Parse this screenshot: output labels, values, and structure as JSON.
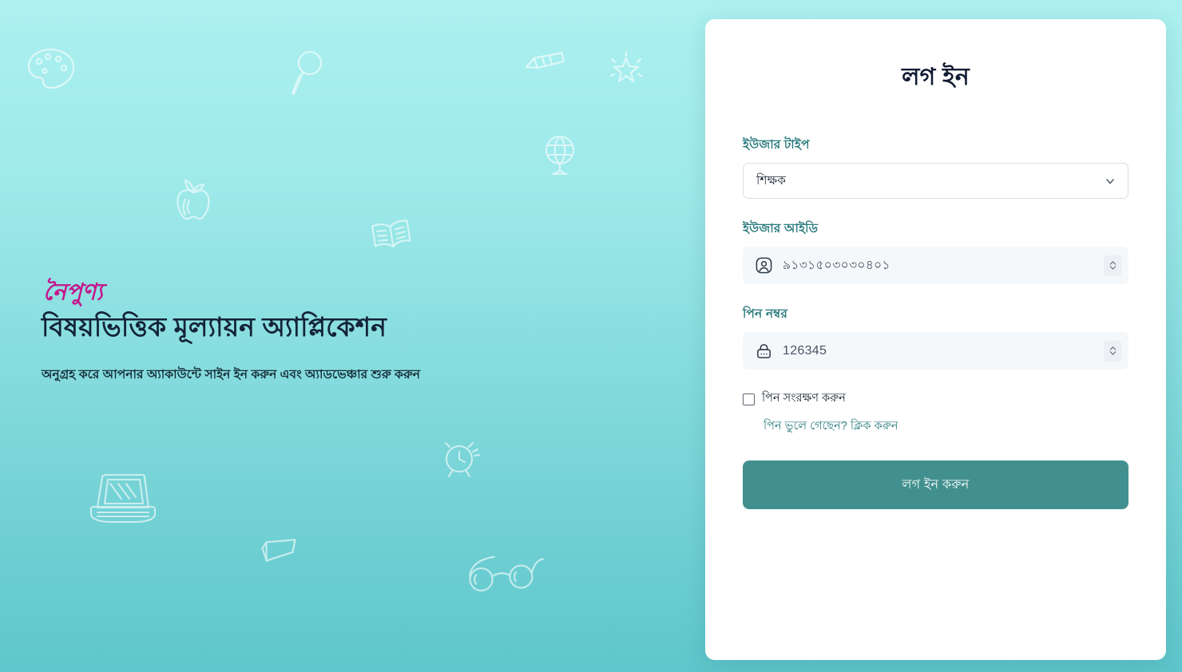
{
  "theme": {
    "bg_gradient_top": "#adf0f0",
    "bg_gradient_bottom": "#5ec6cc",
    "brand_magenta": "#c5168c",
    "label_teal": "#2c7b7e",
    "button_teal": "#41908f",
    "card_bg": "#ffffff",
    "input_bg": "#f5f8fa",
    "heading_navy": "#111c33"
  },
  "hero": {
    "logo_text": "নৈপুণ্য",
    "logo_icon": "naipunno-wordmark-logo",
    "title": "বিষয়ভিত্তিক মূল্যায়ন অ্যাপ্লিকেশন",
    "subtitle": "অনুগ্রহ করে আপনার অ্যাকাউন্টে সাইন ইন করুন এবং অ্যাডভেঞ্চার শুরু করুন"
  },
  "background_doodles": [
    "paint-palette-icon",
    "magnifier-icon",
    "pencil-icon",
    "sparkle-star-icon",
    "apple-icon",
    "open-book-icon",
    "globe-icon",
    "laptop-icon",
    "alarm-clock-icon",
    "eraser-icon",
    "eyeglasses-icon"
  ],
  "card": {
    "title": "লগ ইন",
    "user_type": {
      "label": "ইউজার টাইপ",
      "selected": "শিক্ষক",
      "options": [
        "শিক্ষক"
      ],
      "chevron_icon": "chevron-down-icon"
    },
    "user_id": {
      "label": "ইউজার আইডি",
      "value": "৯১৩১৫০৩০৩০৪০১",
      "icon": "user-circle-icon",
      "spinner_icon": "number-stepper-icon"
    },
    "pin": {
      "label": "পিন নম্বর",
      "value": "126345",
      "icon": "lock-icon",
      "spinner_icon": "number-stepper-icon"
    },
    "remember": {
      "label": "পিন সংরক্ষণ করুন",
      "checked": false
    },
    "forgot_link": "পিন ভুলে গেছেন? ক্লিক করুন",
    "submit_label": "লগ ইন করুন"
  }
}
